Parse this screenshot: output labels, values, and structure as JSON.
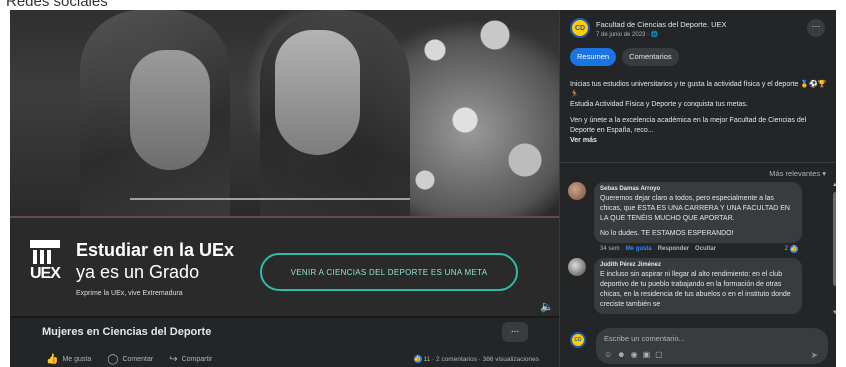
{
  "page": {
    "heading": "Redes sociales"
  },
  "banner": {
    "title_line1": "Estudiar en la UEx",
    "title_line2": "ya es un Grado",
    "subtitle": "Exprime la UEx, vive Extremadura",
    "cta": "VENIR A CIENCIAS DEL DEPORTE ES UNA META",
    "logo_text": "UEX"
  },
  "post": {
    "title": "Mujeres en Ciencias del Deporte",
    "more": "...",
    "actions": {
      "like": "Me gusta",
      "comment": "Comentar",
      "share": "Compartir"
    },
    "stats": "11 · 2 comentarios · 386 visualizaciones"
  },
  "sidebar": {
    "page_name": "Facultad de Ciencias del Deporte. UEX",
    "date": "7 de junio de 2023 ·",
    "avatar_text": "CD",
    "more": "···",
    "tabs": [
      "Resumen",
      "Comentarios"
    ],
    "text_p1": "Inicias tus estudios universitarios y te gusta la actividad física y el deporte 🏅⚽🏆🏃",
    "text_p1b": "Estudia Actividad Física y Deporte y conquista tus metas.",
    "text_p2": "Ven y únete a la excelencia académica en la mejor Facultad de Ciencias del Deporte en España, reco...",
    "see_more": "Ver más",
    "sort": "Más relevantes"
  },
  "comments": [
    {
      "name": "Sebas Damas Arroyo",
      "text": "Queremos dejar claro a todos, pero especialmente a las chicas, que ESTA ES UNA CARRERA Y UNA FACULTAD EN LA QUE TENÉIS MUCHO QUE APORTAR.",
      "text2": "No lo dudes. TE ESTAMOS ESPERANDO!",
      "time": "34 sem",
      "liked": "Me gusta",
      "reply": "Responder",
      "hide": "Ocultar",
      "likes": "2"
    },
    {
      "name": "Judith Pérez Jiménez",
      "text": "E incluso sin aspirar ni llegar al alto rendimiento: en el club deportivo de tu pueblo trabajando en la formación de otras chicas, en la residencia de tus abuelos o en el instituto donde creciste también se"
    }
  ],
  "composer": {
    "placeholder": "Escribe un comentario..."
  }
}
